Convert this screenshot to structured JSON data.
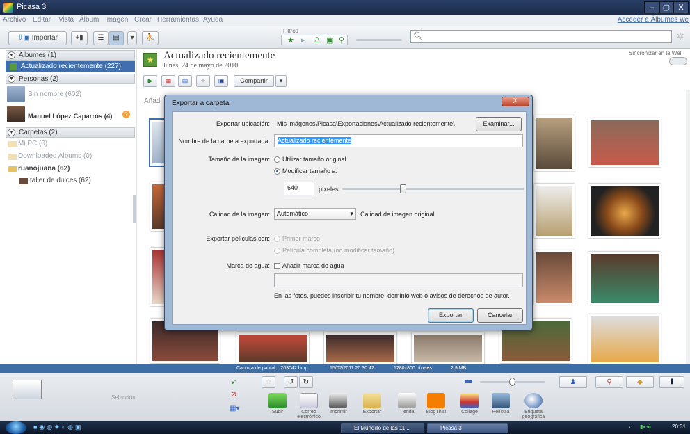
{
  "window": {
    "title": "Picasa 3",
    "min": "–",
    "max": "▢",
    "close": "X"
  },
  "menu": {
    "items": [
      "Archivo",
      "Editar",
      "Vista",
      "Álbum",
      "Imagen",
      "Crear",
      "Herramientas",
      "Ayuda"
    ],
    "link": "Acceder a Álbumes we"
  },
  "toolbar": {
    "import_label": "Importar",
    "filters_label": "Filtros"
  },
  "sidebar": {
    "albums_header": "Álbumes (1)",
    "albums_selected": "Actualizado recientemente (227)",
    "people_header": "Personas (2)",
    "people": [
      {
        "label": "Sin nombre (602)"
      },
      {
        "label": "Manuel López Caparrós (4)"
      }
    ],
    "folders_header": "Carpetas (2)",
    "folders": [
      "Mi PC (0)",
      "Downloaded Albums (0)",
      "ruanojuana (62)",
      "taller de dulces (62)"
    ]
  },
  "album": {
    "title": "Actualizado recientemente",
    "date": "lunes, 24 de mayo de 2010",
    "share_label": "Compartir",
    "sync_label": "Sincronizar en la Wel",
    "photo_caption": "Añadi"
  },
  "dialog": {
    "title": "Exportar a carpeta",
    "close": "X",
    "export_location_label": "Exportar ubicación:",
    "export_location_value": "Mis imágenes\\Picasa\\Exportaciones\\Actualizado recientemente\\",
    "browse_button": "Examinar...",
    "folder_name_label": "Nombre de la carpeta exportada:",
    "folder_name_value": "Actualizado recientemente",
    "image_size_label": "Tamaño de la imagen:",
    "size_original": "Utilizar tamaño original",
    "size_resize": "Modificar tamaño a:",
    "size_value": "640",
    "size_unit": "píxeles",
    "size_slider_fraction": 0.33,
    "quality_label": "Calidad de la imagen:",
    "quality_value": "Automático",
    "quality_note": "Calidad de imagen original",
    "movies_label": "Exportar películas con:",
    "movies_first": "Primer marco",
    "movies_full": "Película completa (no modificar tamaño)",
    "watermark_label": "Marca de agua:",
    "watermark_check": "Añadir marca de agua",
    "watermark_text": "",
    "watermark_hint": "En las fotos, puedes inscribir tu nombre, dominio web o avisos de derechos de autor.",
    "export_button": "Exportar",
    "cancel_button": "Cancelar"
  },
  "status": {
    "file": "Captura de pantal... 203042.bmp",
    "date": "15/02/2011 20:30:42",
    "dims": "1280x800 píxeles",
    "size": "2,9 MB"
  },
  "tray": {
    "selection_label": "Selección",
    "actions": [
      "Subir",
      "Correo electrónico",
      "Imprimir",
      "Exportar",
      "Tienda",
      "BlogThis!",
      "Collage",
      "Película",
      "Etiqueta geográfica"
    ]
  },
  "taskbar": {
    "apps": [
      "El Mundillo de las 11...",
      "Picasa 3"
    ],
    "clock": "20:31"
  },
  "colors": {
    "accent": "#3f6fae",
    "dialog_frame": "#9fb8d6",
    "statusbar": "#3d6fa6"
  }
}
